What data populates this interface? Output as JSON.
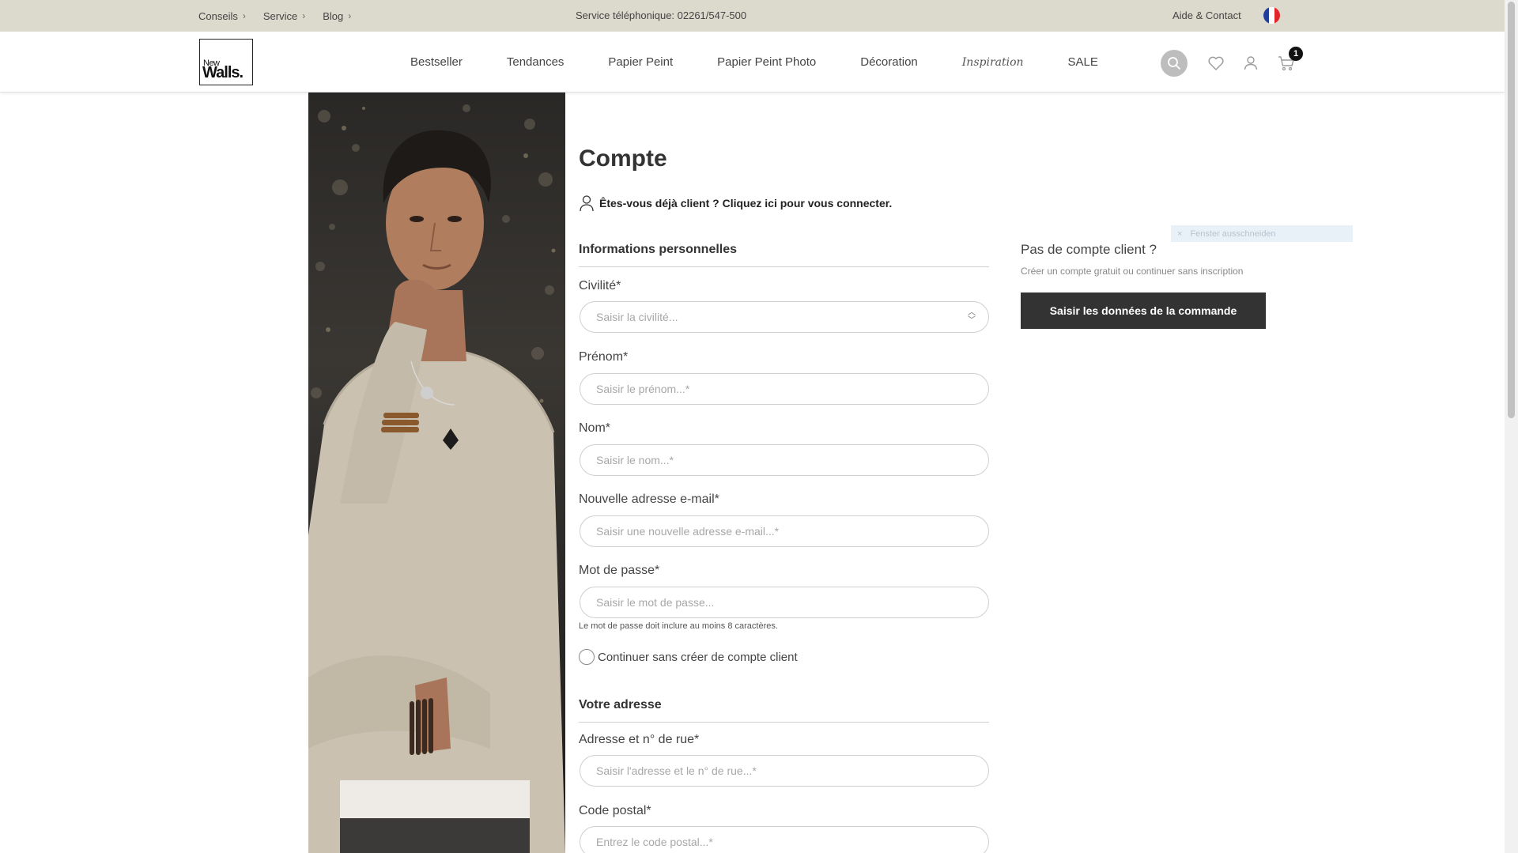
{
  "topbar": {
    "crumbs": [
      {
        "label": "Conseils"
      },
      {
        "label": "Service"
      },
      {
        "label": "Blog"
      }
    ],
    "phone": "Service téléphonique: 02261/547-500",
    "help": "Aide & Contact",
    "flag": {
      "icon": "flag-france-icon",
      "colors": [
        "#1f3f9b",
        "#ffffff",
        "#e1262b"
      ]
    }
  },
  "header": {
    "logo": {
      "top": "New",
      "bottom": "Walls."
    },
    "nav": [
      "Bestseller",
      "Tendances",
      "Papier Peint",
      "Papier Peint Photo",
      "Décoration",
      "Inspiration",
      "SALE"
    ],
    "icons": [
      "search-icon",
      "heart-icon",
      "user-icon",
      "cart-icon"
    ],
    "cart_count": "1"
  },
  "form": {
    "title": "Compte",
    "login_hint": "Êtes-vous déjà client ? Cliquez ici pour vous connecter.",
    "personal_heading": "Informations personnelles",
    "civilite": {
      "label": "Civilité*",
      "placeholder": "Saisir la civilité..."
    },
    "prenom": {
      "label": "Prénom*",
      "placeholder": "Saisir le prénom...*"
    },
    "nom": {
      "label": "Nom*",
      "placeholder": "Saisir le nom...*"
    },
    "email": {
      "label": "Nouvelle adresse e-mail*",
      "placeholder": "Saisir une nouvelle adresse e-mail...*"
    },
    "password": {
      "label": "Mot de passe*",
      "placeholder": "Saisir le mot de passe...",
      "hint": "Le mot de passe doit inclure au moins 8 caractères."
    },
    "guest_checkbox": "Continuer sans créer de compte client",
    "address_heading": "Votre adresse",
    "street": {
      "label": "Adresse et n° de rue*",
      "placeholder": "Saisir l'adresse et le n° de rue...*"
    },
    "postal": {
      "label": "Code postal*",
      "placeholder": "Entrez le code postal...*"
    }
  },
  "guest": {
    "title": "Pas de compte client ?",
    "subtitle": "Créer un compte gratuit ou continuer sans inscription",
    "button": "Saisir les données de la commande"
  },
  "ext_widget": {
    "label": "Fenster ausschneiden"
  },
  "colors": {
    "topbar_bg": "#dcd9cd",
    "button_bg": "#333333",
    "text": "#333333"
  }
}
